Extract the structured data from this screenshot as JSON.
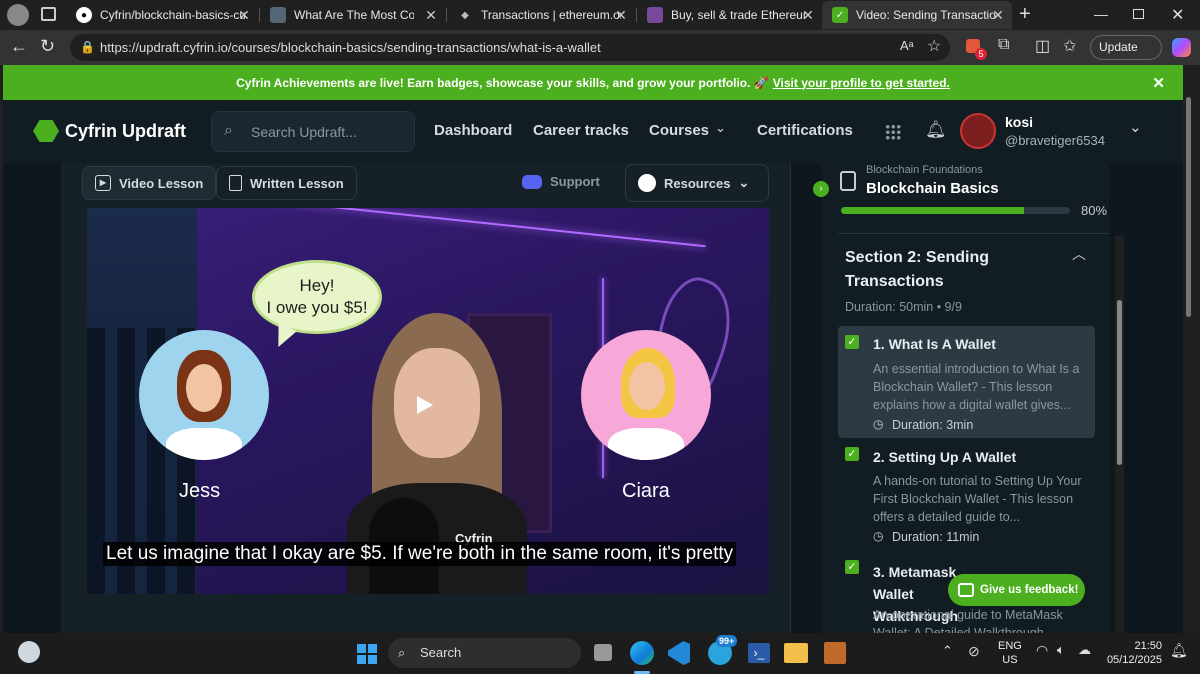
{
  "browser": {
    "tabs": [
      {
        "title": "Cyfrin/blockchain-basics-cu",
        "active": false
      },
      {
        "title": "What Are The Most Commo",
        "active": false
      },
      {
        "title": "Transactions | ethereum.org",
        "active": false
      },
      {
        "title": "Buy, sell & trade Ethereum a",
        "active": false
      },
      {
        "title": "Video: Sending Transactions",
        "active": true
      }
    ],
    "url": "https://updraft.cyfrin.io/courses/blockchain-basics/sending-transactions/what-is-a-wallet",
    "update_label": "Update",
    "badge_count": "5"
  },
  "banner": {
    "text": "Cyfrin Achievements are live! Earn badges, showcase your skills, and grow your portfolio. 🚀",
    "link": "Visit your profile to get started."
  },
  "header": {
    "logo": "Cyfrin Updraft",
    "search_placeholder": "Search Updraft...",
    "nav": [
      "Dashboard",
      "Career tracks",
      "Courses",
      "Certifications"
    ],
    "user_name": "kosi",
    "user_handle": "@bravetiger6534"
  },
  "lesson_tabs": {
    "video": "Video Lesson",
    "written": "Written Lesson",
    "support": "Support",
    "resources": "Resources"
  },
  "video": {
    "bubble_line1": "Hey!",
    "bubble_line2": "I owe you $5!",
    "left_name": "Jess",
    "right_name": "Ciara",
    "shirt_logo": "Cyfrin",
    "caption": "Let us imagine that I okay are $5. If we're both in the same room, it's pretty"
  },
  "sidebar": {
    "course_category": "Blockchain Foundations",
    "course_title": "Blockchain Basics",
    "progress_label": "80%",
    "progress": 0.8,
    "section_title": "Section 2: Sending Transactions",
    "section_meta": "Duration: 50min • 9/9",
    "lessons": [
      {
        "title": "1. What Is A Wallet",
        "desc": "An essential introduction to What Is a Blockchain Wallet? - This lesson explains how a digital wallet gives...",
        "duration": "Duration: 3min"
      },
      {
        "title": "2. Setting Up A Wallet",
        "desc": "A hands-on tutorial to Setting Up Your First Blockchain Wallet - This lesson offers a detailed guide to...",
        "duration": "Duration: 11min"
      },
      {
        "title": "3. Metamask Wallet Walkthrough",
        "desc": "An operational guide to MetaMask Wallet: A Detailed Walkthrough..."
      }
    ],
    "feedback": "Give us feedback!"
  },
  "taskbar": {
    "search": "Search",
    "tray_badge": "99+",
    "lang1": "ENG",
    "lang2": "US",
    "time": "21:50",
    "date": "05/12/2025"
  }
}
